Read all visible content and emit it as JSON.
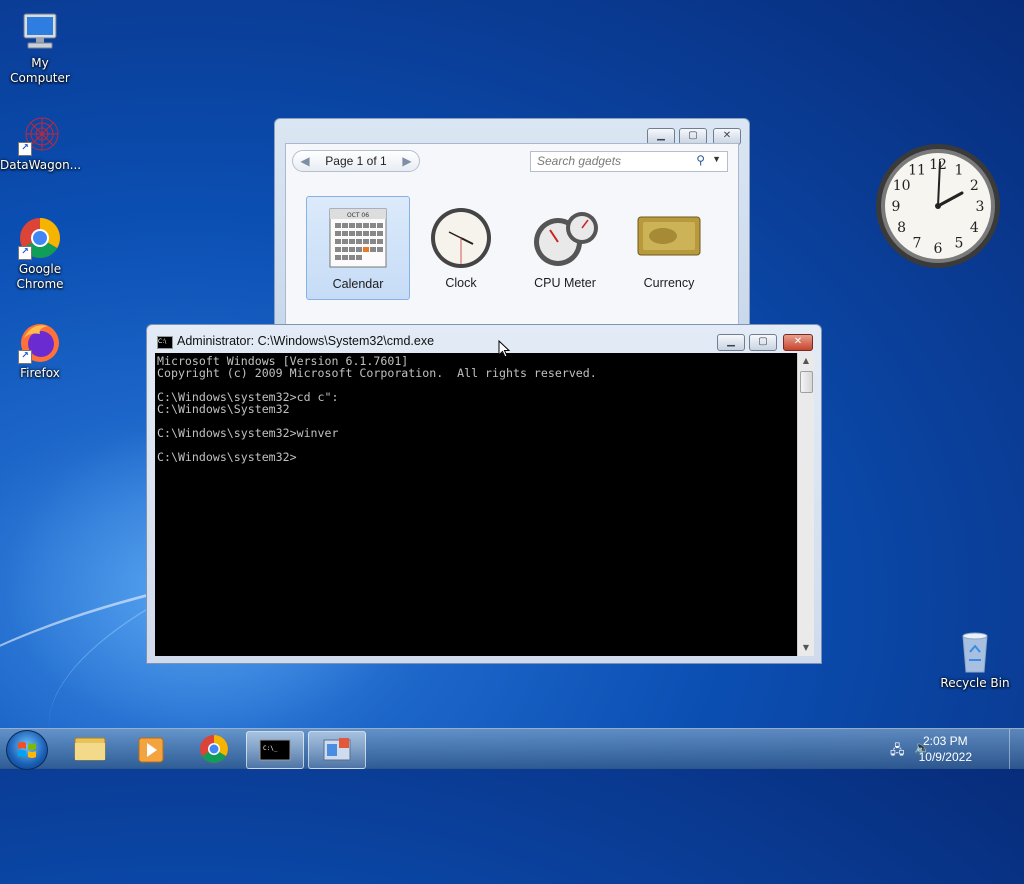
{
  "desktop": {
    "icons": [
      {
        "label": "My Computer"
      },
      {
        "label": "DataWagon..."
      },
      {
        "label": "Google Chrome"
      },
      {
        "label": "Firefox"
      },
      {
        "label": "Recycle Bin"
      }
    ]
  },
  "gadget_gallery": {
    "page_label": "Page 1 of 1",
    "search_placeholder": "Search gadgets",
    "gadgets": [
      {
        "name": "Calendar",
        "selected": true
      },
      {
        "name": "Clock"
      },
      {
        "name": "CPU Meter"
      },
      {
        "name": "Currency"
      }
    ],
    "calendar_month": "OCT 06"
  },
  "desktop_clock": {
    "numerals": [
      "12",
      "1",
      "2",
      "3",
      "4",
      "5",
      "6",
      "7",
      "8",
      "9",
      "10",
      "11"
    ]
  },
  "cmd": {
    "title": "Administrator: C:\\Windows\\System32\\cmd.exe",
    "lines": [
      "Microsoft Windows [Version 6.1.7601]",
      "Copyright (c) 2009 Microsoft Corporation.  All rights reserved.",
      "",
      "C:\\Windows\\system32>cd c\":",
      "C:\\Windows\\System32",
      "",
      "C:\\Windows\\system32>winver",
      "",
      "C:\\Windows\\system32>"
    ]
  },
  "taskbar": {
    "time": "2:03 PM",
    "date": "10/9/2022"
  },
  "colors": {
    "desktop_blue": "#0b4fb3",
    "console_bg": "#000000",
    "console_fg": "#c0c0c0",
    "close_red": "#c6452c"
  }
}
